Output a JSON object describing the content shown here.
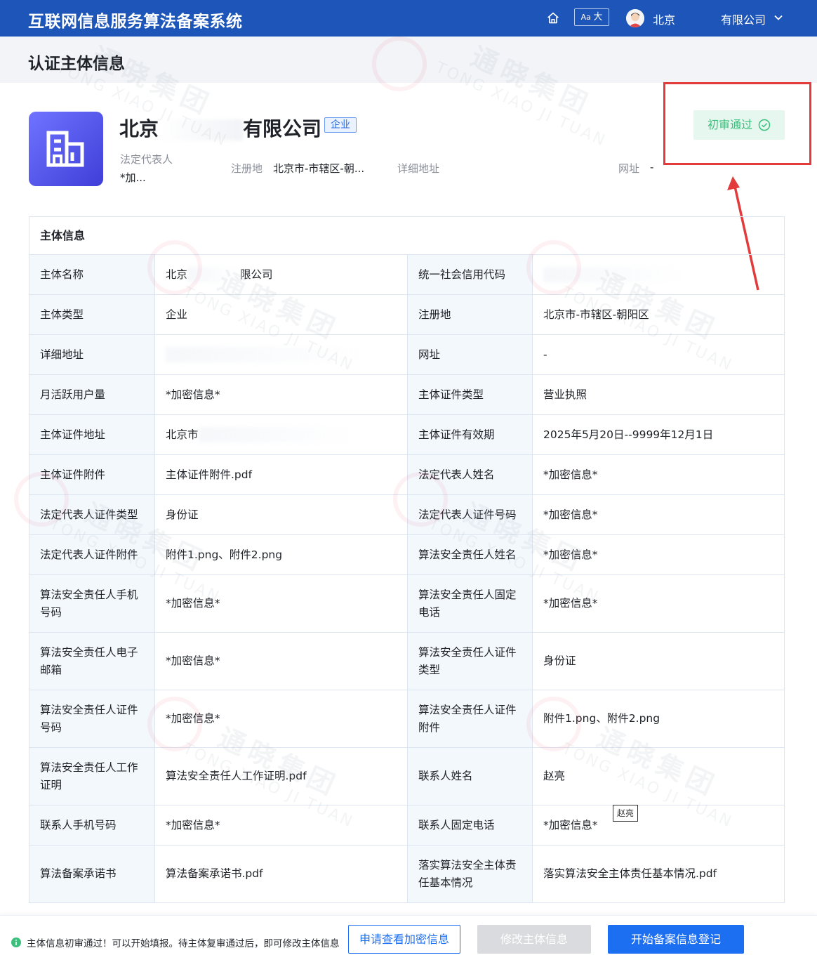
{
  "header": {
    "app_title": "互联网信息服务算法备案系统",
    "font_toggle_small": "Aa",
    "font_toggle_big": "大",
    "user_city": "北京",
    "org_name": "有限公司"
  },
  "page": {
    "title": "认证主体信息"
  },
  "entity": {
    "name_prefix": "北京",
    "name_suffix": "有限公司",
    "type_tag": "企业",
    "legal_rep_label": "法定代表人",
    "legal_rep_value": "*加...",
    "reg_place_label": "注册地",
    "reg_place_value": "北京市-市辖区-朝...",
    "address_label": "详细地址",
    "website_label": "网址",
    "website_value": "-",
    "status": "初审通过"
  },
  "table": {
    "header": "主体信息",
    "rows": [
      {
        "l1": "主体名称",
        "v1a": "北京",
        "v1b": "限公司",
        "l2": "统一社会信用代码",
        "v2": ""
      },
      {
        "l1": "主体类型",
        "v1": "企业",
        "l2": "注册地",
        "v2": "北京市-市辖区-朝阳区"
      },
      {
        "l1": "详细地址",
        "v1": "",
        "l2": "网址",
        "v2": "-"
      },
      {
        "l1": "月活跃用户量",
        "v1": "*加密信息*",
        "l2": "主体证件类型",
        "v2": "营业执照"
      },
      {
        "l1": "主体证件地址",
        "v1": "北京市",
        "l2": "主体证件有效期",
        "v2": "2025年5月20日--9999年12月1日"
      },
      {
        "l1": "主体证件附件",
        "v1": "主体证件附件.pdf",
        "l2": "法定代表人姓名",
        "v2": "*加密信息*"
      },
      {
        "l1": "法定代表人证件类型",
        "v1": "身份证",
        "l2": "法定代表人证件号码",
        "v2": "*加密信息*"
      },
      {
        "l1": "法定代表人证件附件",
        "v1": "附件1.png、附件2.png",
        "l2": "算法安全责任人姓名",
        "v2": "*加密信息*"
      },
      {
        "l1": "算法安全责任人手机号码",
        "v1": "*加密信息*",
        "l2": "算法安全责任人固定电话",
        "v2": "*加密信息*"
      },
      {
        "l1": "算法安全责任人电子邮箱",
        "v1": "*加密信息*",
        "l2": "算法安全责任人证件类型",
        "v2": "身份证"
      },
      {
        "l1": "算法安全责任人证件号码",
        "v1": "*加密信息*",
        "l2": "算法安全责任人证件附件",
        "v2": "附件1.png、附件2.png"
      },
      {
        "l1": "算法安全责任人工作证明",
        "v1": "算法安全责任人工作证明.pdf",
        "l2": "联系人姓名",
        "v2": "赵亮"
      },
      {
        "l1": "联系人手机号码",
        "v1": "*加密信息*",
        "l2": "联系人固定电话",
        "v2": "*加密信息*"
      },
      {
        "l1": "算法备案承诺书",
        "v1": "算法备案承诺书.pdf",
        "l2": "落实算法安全主体责任基本情况",
        "v2": "落实算法安全主体责任基本情况.pdf"
      }
    ]
  },
  "tooltip": "赵亮",
  "footer": {
    "notice": "主体信息初审通过！可以开始填报。待主体复审通过后，即可修改主体信息",
    "btn_request": "申请查看加密信息",
    "btn_modify": "修改主体信息",
    "btn_start": "开始备案信息登记"
  },
  "watermark": {
    "cn": "通晓集团",
    "en": "TONG XIAO JI TUAN"
  },
  "icons": [
    "home-icon",
    "avatar",
    "chevron-down-icon",
    "building-icon",
    "check-circle-icon",
    "info-icon"
  ],
  "colors": {
    "brand_blue": "#1d56b8",
    "primary": "#1d6ff2",
    "success": "#3bbf7c",
    "annotation_red": "#e23b3b"
  }
}
